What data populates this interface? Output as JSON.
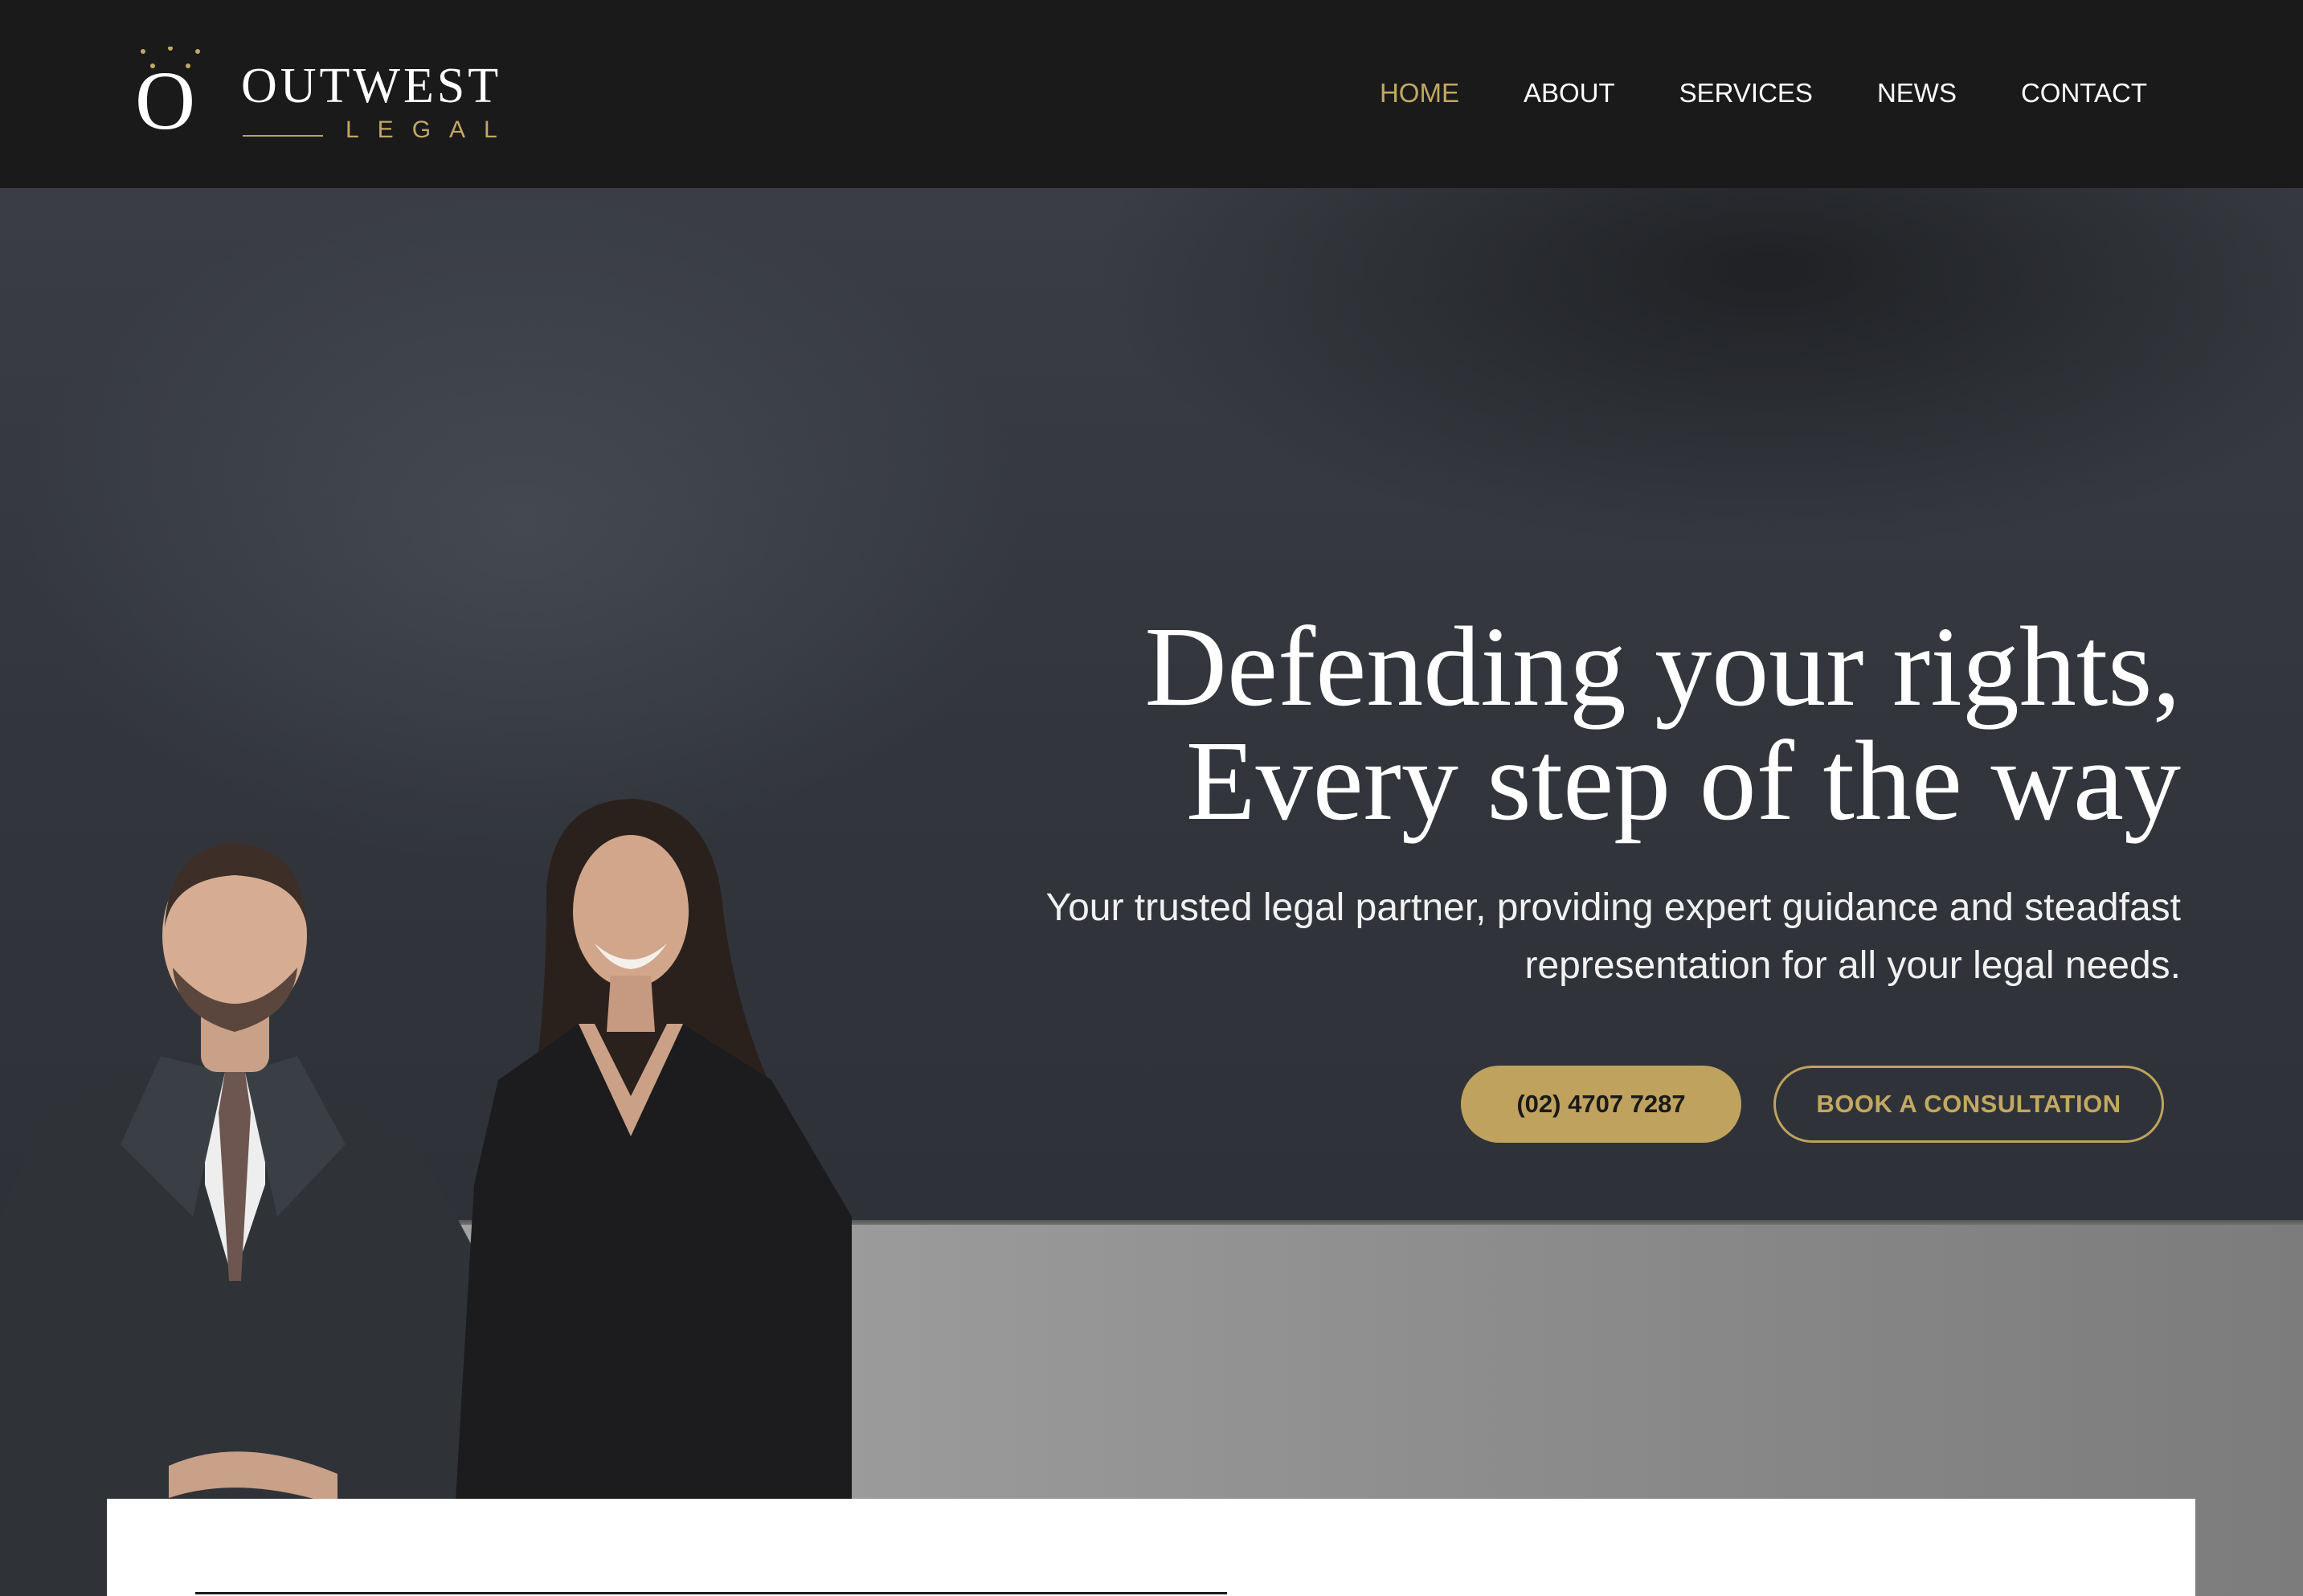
{
  "header": {
    "logo": {
      "mark": "O",
      "word": "OUTWEST",
      "sub": "LEGAL"
    },
    "nav": [
      {
        "label": "HOME",
        "active": true
      },
      {
        "label": "ABOUT",
        "active": false
      },
      {
        "label": "SERVICES",
        "active": false
      },
      {
        "label": "NEWS",
        "active": false
      },
      {
        "label": "CONTACT",
        "active": false
      }
    ]
  },
  "hero": {
    "title_line1": "Defending your rights,",
    "title_line2": "Every step of the way",
    "subtitle_line1": "Your trusted legal partner, providing expert guidance and steadfast",
    "subtitle_line2": "representation for all your legal needs.",
    "phone_button": "(02) 4707 7287",
    "consult_button": "BOOK A CONSULTATION",
    "image_icon": "team-photo"
  },
  "colors": {
    "accent_gold": "#bfa25e",
    "header_bg": "#1a1a1b",
    "text_white": "#ffffff"
  }
}
